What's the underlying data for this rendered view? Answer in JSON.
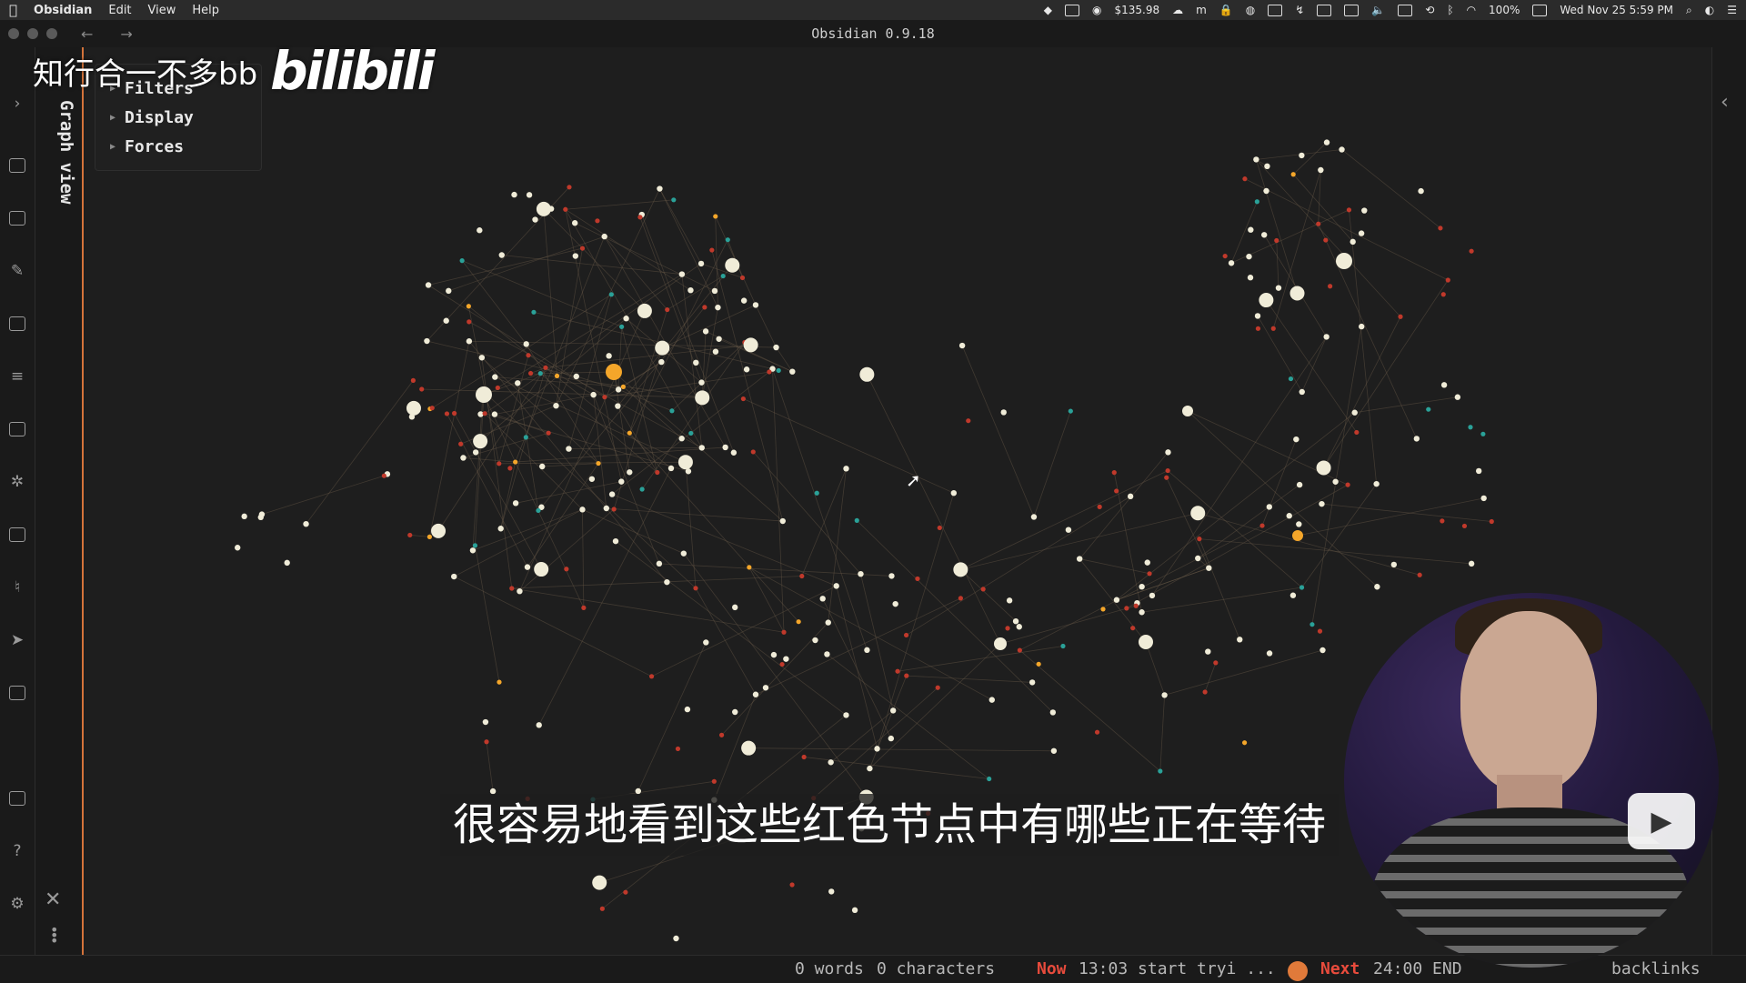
{
  "menubar": {
    "apple_icon": "apple-icon",
    "items": [
      "Obsidian",
      "Edit",
      "View",
      "Help"
    ],
    "price": "$135.98",
    "battery": "100%",
    "datetime": "Wed Nov 25  5:59 PM"
  },
  "window": {
    "title": "Obsidian 0.9.18",
    "back": "←",
    "forward": "→"
  },
  "sidebar": {
    "tab_title": "Graph view",
    "close_glyph": "✕",
    "more_glyph": "⋮"
  },
  "graph_controls": {
    "items": [
      {
        "label": "Filters",
        "collapsed": true
      },
      {
        "label": "Display",
        "collapsed": true
      },
      {
        "label": "Forces",
        "collapsed": true
      }
    ],
    "triangle": "▶"
  },
  "right_edge": {
    "expand_glyph": "‹"
  },
  "statusbar": {
    "words": "0 words",
    "characters": "0 characters",
    "now_label": "Now",
    "now_task": "13:03 start tryi ...",
    "next_label": "Next",
    "next_task": "24:00 END",
    "backlinks": "backlinks"
  },
  "overlay": {
    "watermark_text": "知行合一不多bb",
    "watermark_logo": "bilibili",
    "subtitle": "很容易地看到这些红色节点中有哪些正在等待"
  },
  "colors": {
    "node_white": "#f0ecd8",
    "node_orange": "#f4a62a",
    "node_red": "#c0392b",
    "node_teal": "#2aa198",
    "edge": "#6b5a4a",
    "accent": "#d4733a",
    "status_red": "#e84b3c"
  }
}
